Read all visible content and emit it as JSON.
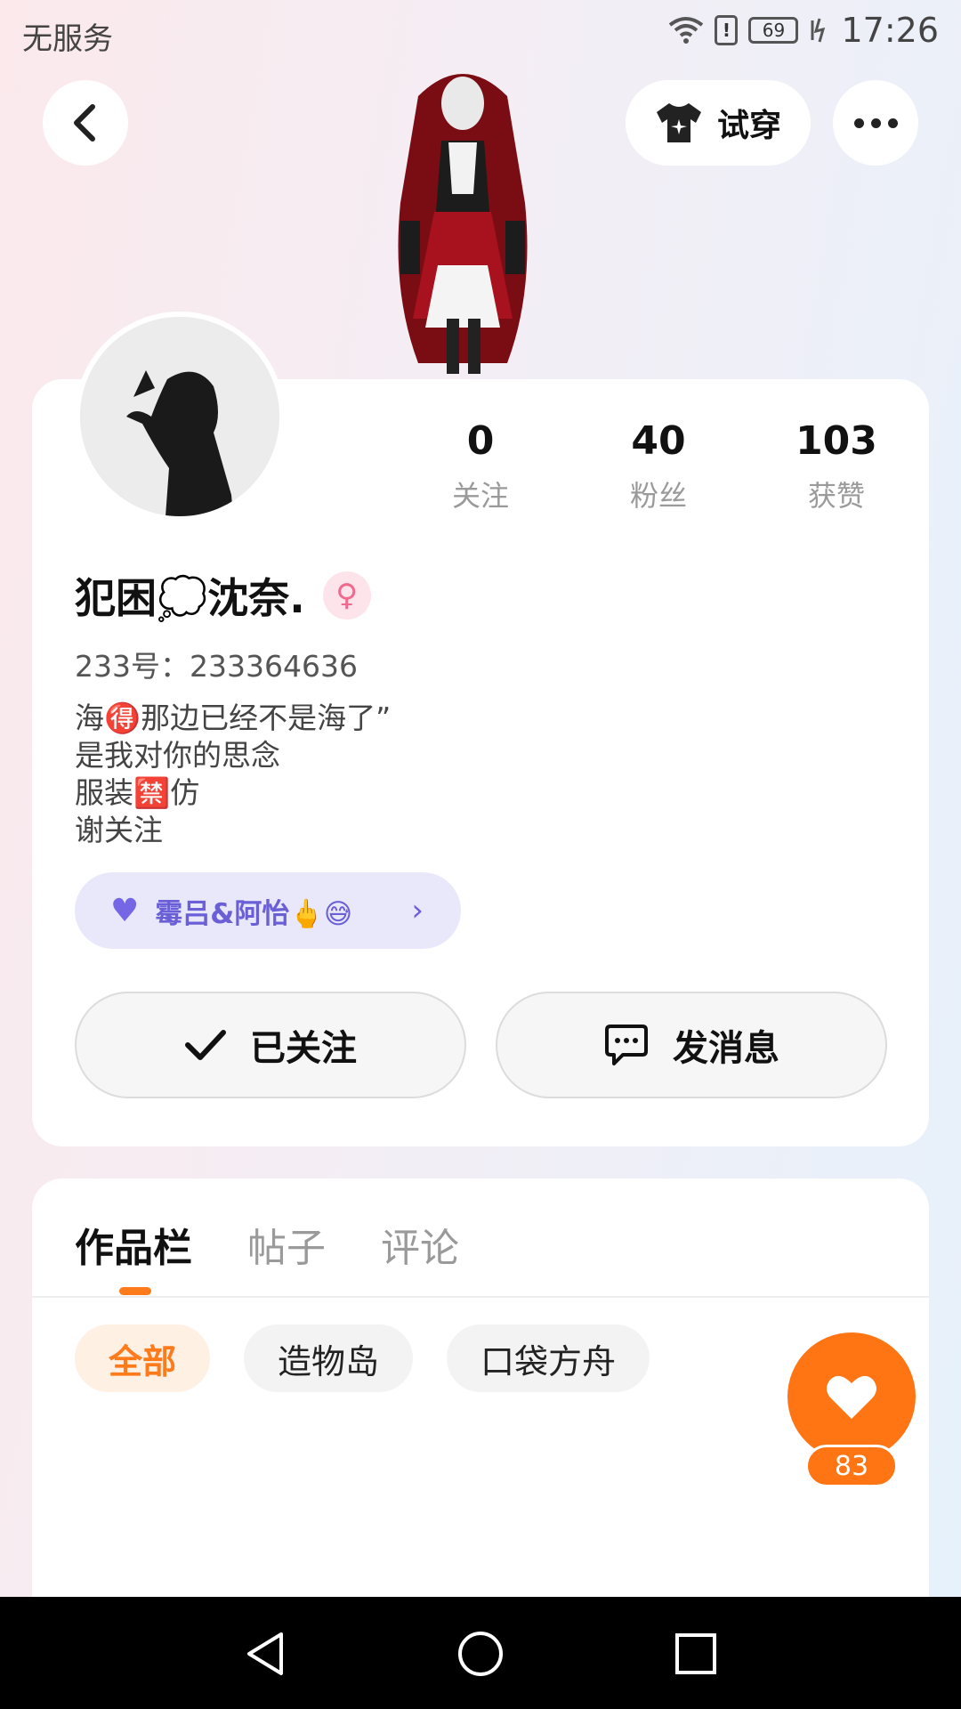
{
  "status_bar": {
    "carrier": "无服务",
    "alert_glyph": "!",
    "battery": "69",
    "time": "17:26"
  },
  "top_bar": {
    "try_on_label": "试穿"
  },
  "profile": {
    "stats": [
      {
        "value": "0",
        "label": "关注"
      },
      {
        "value": "40",
        "label": "粉丝"
      },
      {
        "value": "103",
        "label": "获赞"
      }
    ],
    "name": "犯困💭沈奈.",
    "gender_icon": "female-icon",
    "uid": "233号：233364636",
    "bio_lines": [
      "海🉐那边已经不是海了”",
      "是我对你的思念",
      "服装🈲仿",
      "谢关注"
    ],
    "couple": {
      "label": "霉吕&阿怡🖕😅"
    },
    "follow_label": "已关注",
    "message_label": "发消息"
  },
  "works": {
    "tabs": [
      {
        "label": "作品栏",
        "active": true
      },
      {
        "label": "帖子",
        "active": false
      },
      {
        "label": "评论",
        "active": false
      }
    ],
    "chips": [
      {
        "label": "全部",
        "active": true
      },
      {
        "label": "造物岛",
        "active": false
      },
      {
        "label": "口袋方舟",
        "active": false
      }
    ]
  },
  "like_fab": {
    "count": "83"
  },
  "colors": {
    "accent": "#ff7413",
    "couple_purple": "#6a5fd6",
    "gender_pink": "#f06a8f"
  }
}
